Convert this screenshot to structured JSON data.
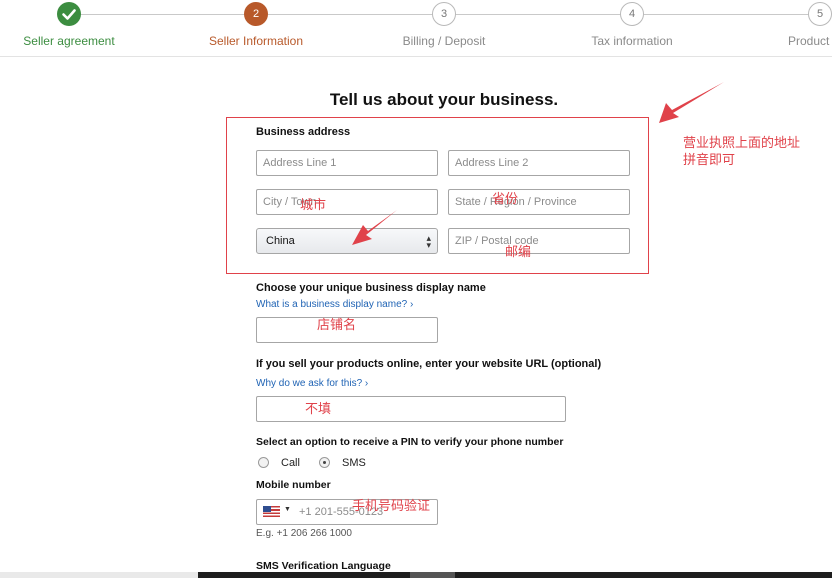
{
  "steps": [
    {
      "label": "Seller agreement",
      "status": "done"
    },
    {
      "label": "Seller Information",
      "number": "2",
      "status": "current"
    },
    {
      "label": "Billing / Deposit",
      "number": "3",
      "status": "todo"
    },
    {
      "label": "Tax information",
      "number": "4",
      "status": "todo"
    },
    {
      "label": "Product info",
      "number": "5",
      "status": "todo"
    }
  ],
  "page_title": "Tell us about your business.",
  "address": {
    "heading": "Business address",
    "line1_placeholder": "Address Line 1",
    "line2_placeholder": "Address Line 2",
    "city_placeholder": "City / Town",
    "state_placeholder": "State / Region / Province",
    "country_value": "China",
    "zip_placeholder": "ZIP / Postal code"
  },
  "display_name": {
    "heading": "Choose your unique business display name",
    "link": "What is a business display name? ›",
    "value": ""
  },
  "website": {
    "heading": "If you sell your products online, enter your website URL (optional)",
    "link": "Why do we ask for this? ›",
    "value": ""
  },
  "pin": {
    "heading": "Select an option to receive a PIN to verify your phone number",
    "options": [
      "Call",
      "SMS"
    ],
    "selected": "SMS"
  },
  "mobile": {
    "heading": "Mobile number",
    "placeholder": "+1 201-555-0123",
    "example": "E.g. +1 206 266 1000",
    "country_flag": "us-flag-icon"
  },
  "sms_language_heading": "SMS Verification Language",
  "annotations": {
    "address_note": "营业执照上面的地址\n拼音即可",
    "city": "城市",
    "province": "省份",
    "zip": "邮编",
    "store_name": "店铺名",
    "website": "不填",
    "phone": "手机号码验证"
  },
  "colors": {
    "done_green": "#3c8d40",
    "current_orange": "#b8592a",
    "annotation_red": "#e0424a",
    "link_blue": "#1f63b4"
  }
}
